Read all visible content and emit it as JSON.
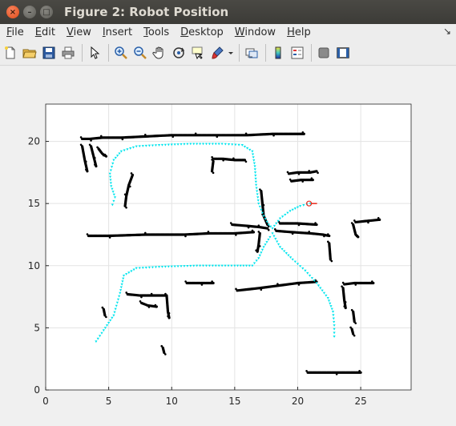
{
  "window": {
    "title": "Figure 2: Robot Position",
    "controls": [
      "close",
      "minimize",
      "maximize"
    ]
  },
  "menubar": {
    "items": [
      {
        "label": "File",
        "mnemonic": "F",
        "rest": "ile"
      },
      {
        "label": "Edit",
        "mnemonic": "E",
        "rest": "dit"
      },
      {
        "label": "View",
        "mnemonic": "V",
        "rest": "iew"
      },
      {
        "label": "Insert",
        "mnemonic": "I",
        "rest": "nsert"
      },
      {
        "label": "Tools",
        "mnemonic": "T",
        "rest": "ools"
      },
      {
        "label": "Desktop",
        "mnemonic": "D",
        "rest": "esktop"
      },
      {
        "label": "Window",
        "mnemonic": "W",
        "rest": "indow"
      },
      {
        "label": "Help",
        "mnemonic": "H",
        "rest": "elp"
      }
    ],
    "dock_icon": "dock-arrow-icon"
  },
  "toolbar": {
    "buttons": [
      "new-figure-icon",
      "open-file-icon",
      "save-icon",
      "print-icon",
      "edit-plot-arrow-icon",
      "zoom-in-icon",
      "zoom-out-icon",
      "pan-hand-icon",
      "rotate-3d-icon",
      "data-cursor-icon",
      "brush-icon",
      "link-plot-icon",
      "insert-colorbar-icon",
      "insert-legend-icon",
      "hide-plot-tools-icon",
      "show-plot-tools-icon"
    ]
  },
  "chart_data": {
    "type": "scatter",
    "title": "",
    "xlabel": "",
    "ylabel": "",
    "xlim": [
      0,
      29
    ],
    "ylim": [
      0,
      23
    ],
    "xticks": [
      "0",
      "5",
      "10",
      "15",
      "20",
      "25"
    ],
    "yticks": [
      "0",
      "5",
      "10",
      "15",
      "20"
    ],
    "grid": true,
    "series": [
      {
        "role": "laser scan obstacle map",
        "color": "#000000",
        "marker": "dot",
        "segments": [
          {
            "x": [
              2.9,
              3.5,
              4.5,
              6,
              8,
              10,
              12,
              13.5,
              16,
              18,
              20.5
            ],
            "y": [
              20.2,
              20.2,
              20.3,
              20.3,
              20.4,
              20.5,
              20.5,
              20.5,
              20.5,
              20.6,
              20.6
            ]
          },
          {
            "x": [
              2.9,
              3.1,
              3.3
            ],
            "y": [
              19.6,
              18.5,
              17.6
            ]
          },
          {
            "x": [
              3.6,
              3.8,
              4.0
            ],
            "y": [
              19.6,
              18.8,
              18.0
            ]
          },
          {
            "x": [
              4.2,
              4.5,
              4.8
            ],
            "y": [
              19.4,
              19.0,
              18.8
            ]
          },
          {
            "x": [
              6.9,
              6.6,
              6.4,
              6.3
            ],
            "y": [
              17.3,
              16.5,
              15.6,
              14.8
            ]
          },
          {
            "x": [
              13.3,
              14,
              15,
              15.8
            ],
            "y": [
              18.6,
              18.6,
              18.5,
              18.5
            ]
          },
          {
            "x": [
              13.3,
              13.2
            ],
            "y": [
              18.4,
              17.6
            ]
          },
          {
            "x": [
              19.3,
              20,
              21,
              21.5
            ],
            "y": [
              17.4,
              17.5,
              17.5,
              17.6
            ]
          },
          {
            "x": [
              19.5,
              20.3,
              21.2
            ],
            "y": [
              16.8,
              16.9,
              16.9
            ]
          },
          {
            "x": [
              17.1,
              17.2,
              17.3,
              17.6
            ],
            "y": [
              16.0,
              15.0,
              14.0,
              13.3
            ]
          },
          {
            "x": [
              3.4,
              5,
              8,
              11,
              13,
              15,
              16.5
            ],
            "y": [
              12.4,
              12.4,
              12.5,
              12.5,
              12.6,
              12.6,
              12.7
            ]
          },
          {
            "x": [
              14.8,
              16,
              17,
              17.6
            ],
            "y": [
              13.3,
              13.2,
              13.1,
              13.0
            ]
          },
          {
            "x": [
              17.0,
              16.9,
              16.8
            ],
            "y": [
              12.6,
              11.7,
              11.1
            ]
          },
          {
            "x": [
              18.3,
              19.5,
              21,
              22,
              22.5
            ],
            "y": [
              12.8,
              12.7,
              12.6,
              12.5,
              12.4
            ]
          },
          {
            "x": [
              18.6,
              20,
              21.5
            ],
            "y": [
              13.4,
              13.4,
              13.3
            ]
          },
          {
            "x": [
              24.6,
              25.5,
              26.5
            ],
            "y": [
              13.5,
              13.6,
              13.7
            ]
          },
          {
            "x": [
              24.4,
              24.6,
              24.8
            ],
            "y": [
              13.3,
              12.5,
              12.3
            ]
          },
          {
            "x": [
              22.5,
              22.6
            ],
            "y": [
              11.8,
              10.5
            ]
          },
          {
            "x": [
              11.2,
              12.3,
              13.3
            ],
            "y": [
              8.6,
              8.6,
              8.6
            ]
          },
          {
            "x": [
              15.2,
              17,
              18.5,
              20,
              21.5
            ],
            "y": [
              8.0,
              8.2,
              8.4,
              8.6,
              8.7
            ]
          },
          {
            "x": [
              6.5,
              7.5,
              8.5,
              9.5
            ],
            "y": [
              7.7,
              7.6,
              7.6,
              7.6
            ]
          },
          {
            "x": [
              9.6,
              9.7,
              9.8
            ],
            "y": [
              7.6,
              6.3,
              5.8
            ]
          },
          {
            "x": [
              7.6,
              8.1,
              8.8
            ],
            "y": [
              7.0,
              6.8,
              6.7
            ]
          },
          {
            "x": [
              4.6,
              4.7
            ],
            "y": [
              6.5,
              6.0
            ]
          },
          {
            "x": [
              9.3,
              9.4
            ],
            "y": [
              3.4,
              3.0
            ]
          },
          {
            "x": [
              23.7,
              24.5,
              26
            ],
            "y": [
              8.5,
              8.6,
              8.6
            ]
          },
          {
            "x": [
              23.6,
              23.7,
              23.8
            ],
            "y": [
              8.2,
              7.2,
              6.6
            ]
          },
          {
            "x": [
              24.4,
              24.5
            ],
            "y": [
              6.3,
              5.5
            ]
          },
          {
            "x": [
              24.3,
              24.4
            ],
            "y": [
              4.9,
              4.5
            ]
          },
          {
            "x": [
              20.8,
              23,
              25
            ],
            "y": [
              1.4,
              1.4,
              1.4
            ]
          }
        ]
      },
      {
        "role": "robot trajectory",
        "color": "#00e5ee",
        "marker": "triangle",
        "x": [
          4.0,
          4.6,
          5.4,
          5.9,
          6.2,
          7.2,
          9.0,
          12.0,
          15.0,
          16.4,
          16.9,
          17.3,
          17.8,
          18.0,
          18.6,
          19.6,
          20.6,
          21.5,
          22.4,
          22.8,
          22.9,
          22.9
        ],
        "y": [
          3.9,
          4.8,
          6.0,
          7.8,
          9.2,
          9.8,
          9.9,
          10.0,
          10.0,
          10.0,
          10.6,
          11.5,
          12.3,
          12.6,
          11.5,
          10.5,
          9.6,
          8.6,
          7.4,
          6.3,
          5.2,
          4.3
        ]
      },
      {
        "role": "robot trajectory (upper loop)",
        "color": "#00e5ee",
        "marker": "triangle",
        "x": [
          5.3,
          5.5,
          5.2,
          5.1,
          5.4,
          6.0,
          7.2,
          9.0,
          11.5,
          14.0,
          15.6,
          16.4,
          16.6,
          16.7,
          16.9,
          17.3,
          17.7,
          18.0,
          18.6,
          19.4,
          20.2,
          21.0
        ],
        "y": [
          14.9,
          15.5,
          16.4,
          17.4,
          18.5,
          19.2,
          19.6,
          19.7,
          19.8,
          19.8,
          19.7,
          19.2,
          18.0,
          16.5,
          15.0,
          14.0,
          13.3,
          13.0,
          13.8,
          14.4,
          14.8,
          15.0
        ]
      },
      {
        "role": "current robot pose",
        "color": "#e8291c",
        "marker": "circle",
        "x": [
          20.9
        ],
        "y": [
          15.0
        ]
      }
    ]
  }
}
